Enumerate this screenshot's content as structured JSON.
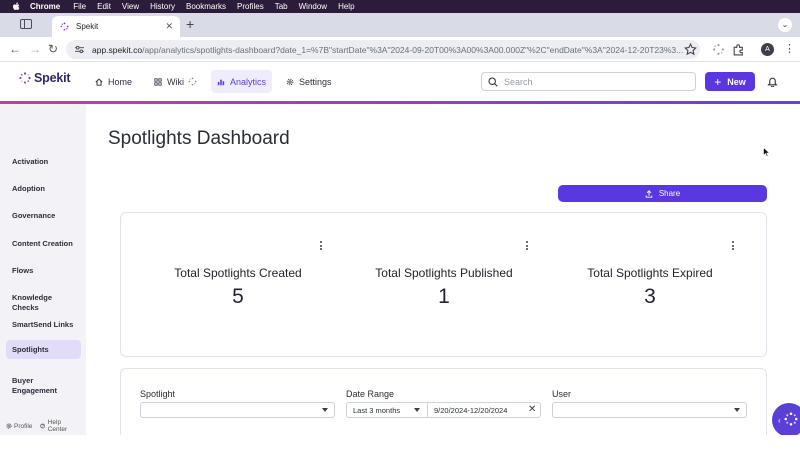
{
  "macos_menu": {
    "app": "Chrome",
    "items": [
      "File",
      "Edit",
      "View",
      "History",
      "Bookmarks",
      "Profiles",
      "Tab",
      "Window",
      "Help"
    ]
  },
  "browser": {
    "tab_title": "Spekit",
    "url_host": "app.spekit.co",
    "url_path": "/app/analytics/spotlights-dashboard?date_1=%7B\"startDate\"%3A\"2024-09-20T00%3A00%3A00.000Z\"%2C\"endDate\"%3A\"2024-12-20T23%3...",
    "profile_initial": "A"
  },
  "header": {
    "logo_text": "Spekit",
    "nav": [
      {
        "label": "Home",
        "icon": "home-icon"
      },
      {
        "label": "Wiki",
        "icon": "grid-icon"
      },
      {
        "label": "Analytics",
        "icon": "bar-chart-icon"
      },
      {
        "label": "Settings",
        "icon": "gear-icon"
      }
    ],
    "active_nav": "Analytics",
    "search_placeholder": "Search",
    "new_label": "New"
  },
  "sidebar": {
    "items": [
      {
        "label": "Activation"
      },
      {
        "label": "Adoption"
      },
      {
        "label": "Governance"
      },
      {
        "label": "Content Creation"
      },
      {
        "label": "Flows"
      },
      {
        "label": "Knowledge Checks"
      },
      {
        "label": "SmartSend Links"
      },
      {
        "label": "Spotlights"
      },
      {
        "label": "Buyer Engagement"
      }
    ],
    "active_item": "Spotlights",
    "footer": {
      "profile": "Profile",
      "help": "Help Center"
    }
  },
  "main": {
    "title": "Spotlights Dashboard",
    "share_label": "Share",
    "stats": [
      {
        "label": "Total Spotlights Created",
        "value": "5"
      },
      {
        "label": "Total Spotlights Published",
        "value": "1"
      },
      {
        "label": "Total Spotlights Expired",
        "value": "3"
      }
    ],
    "filters": {
      "spotlight_label": "Spotlight",
      "spotlight_value": "",
      "date_range_label": "Date Range",
      "date_range_preset": "Last 3 months",
      "date_range_value": "9/20/2024-12/20/2024",
      "user_label": "User",
      "user_value": ""
    }
  },
  "colors": {
    "brand_purple": "#5a37e0",
    "active_nav_bg": "#efedfb",
    "active_sidebar_bg": "#e3dcf8",
    "gradient_start": "#c53ea3",
    "gradient_end": "#6b3ee0"
  }
}
